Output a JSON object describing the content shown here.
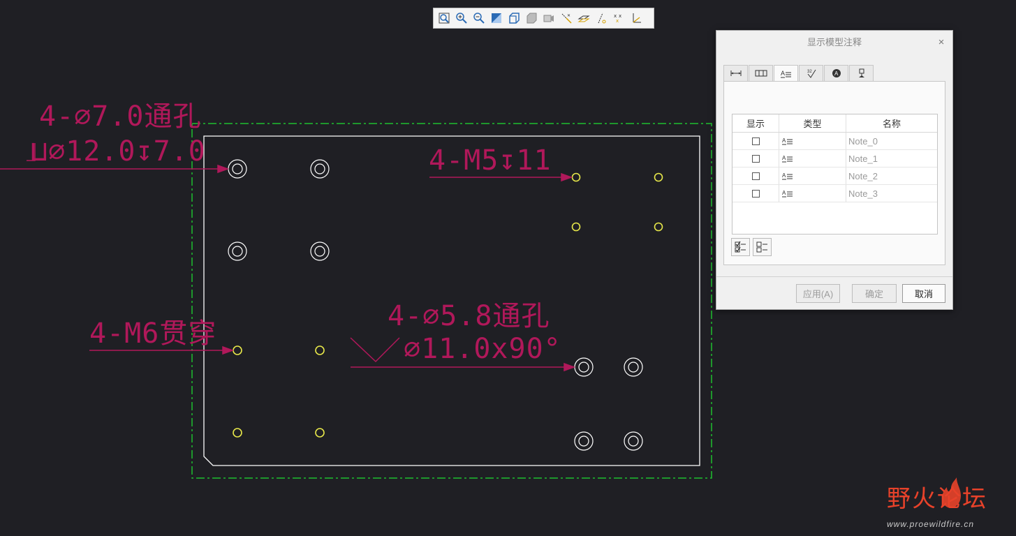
{
  "toolbar": {
    "buttons": [
      "refit-icon",
      "zoom-in-icon",
      "zoom-out-icon",
      "repaint-icon",
      "shading-icon",
      "hidden-line-icon",
      "saved-views-icon",
      "datum-planes-icon",
      "datum-axes-icon",
      "datum-points-icon",
      "coord-sys-icon",
      "annotations-icon"
    ]
  },
  "annotations": {
    "hole1_line1": "4-∅7.0通孔",
    "hole1_line2": "⊔∅12.0↧7.0",
    "hole2": "4-M5↧11",
    "hole3": "4-M6贯穿",
    "hole4_line1": "4-∅5.8通孔",
    "hole4_line2": "∅11.0x90°"
  },
  "colors": {
    "canvas_bg": "#1f1f24",
    "annotation": "#b0185a",
    "part_edge": "#ffffff",
    "bounding_box": "#1fbf2f",
    "thread_hole": "#e8e84a",
    "callout_mark": "#e8202a"
  },
  "dialog": {
    "title": "显示模型注释",
    "close": "×",
    "tabs": [
      "dimension-tab-icon",
      "gtol-tab-icon",
      "note-tab-icon",
      "surface-finish-tab-icon",
      "symbol-tab-icon",
      "datum-tab-icon"
    ],
    "active_tab": 2,
    "table": {
      "headers": {
        "show": "显示",
        "type": "类型",
        "name": "名称"
      },
      "rows": [
        {
          "show": false,
          "type": "note-icon",
          "name": "Note_0"
        },
        {
          "show": false,
          "type": "note-icon",
          "name": "Note_1"
        },
        {
          "show": false,
          "type": "note-icon",
          "name": "Note_2"
        },
        {
          "show": false,
          "type": "note-icon",
          "name": "Note_3"
        }
      ]
    },
    "buttons": {
      "apply": "应用(A)",
      "ok": "确定",
      "cancel": "取消"
    }
  },
  "watermark": {
    "cn": "野火论坛",
    "url": "www.proewildfire.cn"
  }
}
